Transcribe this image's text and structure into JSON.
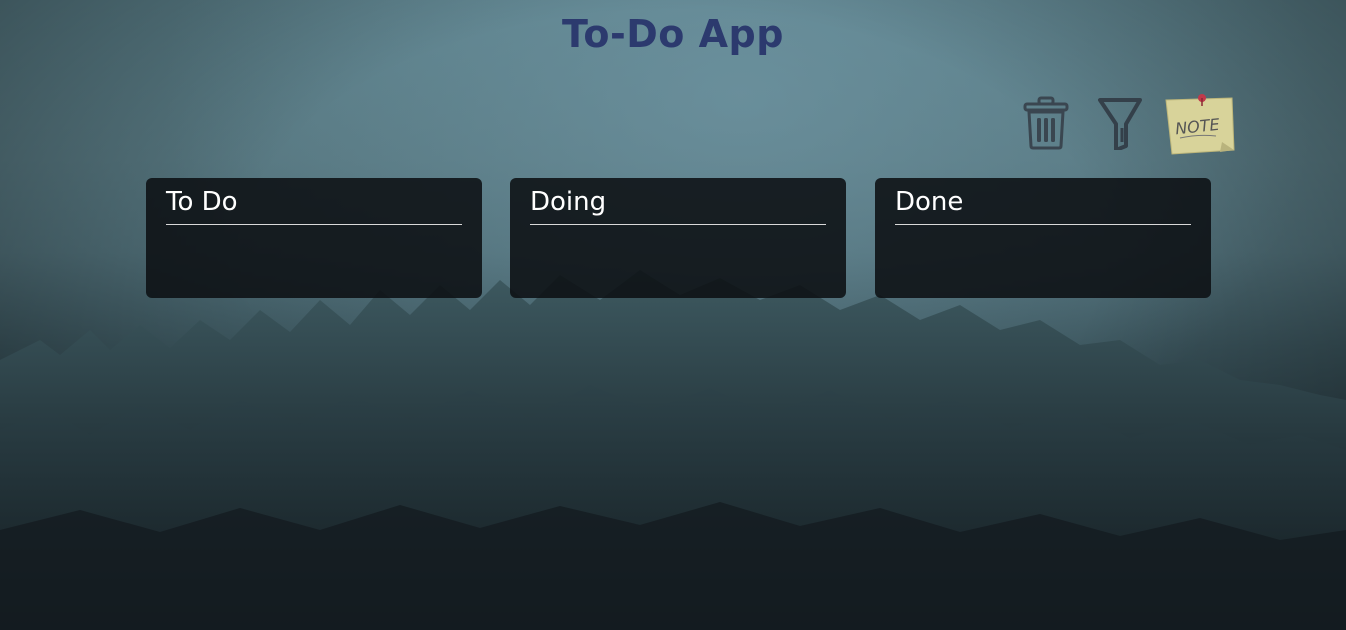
{
  "app": {
    "title": "To-Do App"
  },
  "toolbar": {
    "items": [
      {
        "icon": "trash-icon",
        "label": "Delete"
      },
      {
        "icon": "filter-icon",
        "label": "Filter"
      },
      {
        "icon": "note-icon",
        "text": "NOTE"
      }
    ]
  },
  "board": {
    "columns": [
      {
        "title": "To Do",
        "tasks": []
      },
      {
        "title": "Doing",
        "tasks": []
      },
      {
        "title": "Done",
        "tasks": []
      }
    ]
  },
  "colors": {
    "title": "#2c3a6e",
    "column_bg": "#0c1013",
    "column_text": "#ffffff",
    "icon": "#3a4650",
    "note_paper": "#d8d39a"
  }
}
